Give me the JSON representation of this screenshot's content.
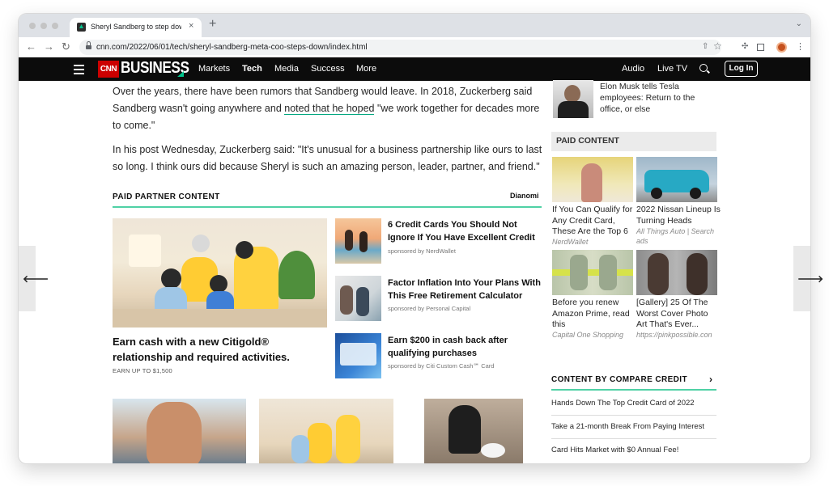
{
  "browser": {
    "tab_title": "Sheryl Sandberg to step down",
    "tab_close": "×",
    "new_tab": "+",
    "url": "cnn.com/2022/06/01/tech/sheryl-sandberg-meta-coo-steps-down/index.html"
  },
  "header": {
    "cnn_logo": "CNN",
    "section_logo": "BUSINESS",
    "nav": [
      "Markets",
      "Tech",
      "Media",
      "Success",
      "More"
    ],
    "right_nav": [
      "Audio",
      "Live TV"
    ],
    "login_label": "Log In"
  },
  "article": {
    "para1_a": "Over the years, there have been rumors that Sandberg would leave. In 2018, Zuckerberg said Sandberg wasn't going anywhere and ",
    "para1_link": "noted that he hoped",
    "para1_b": " \"we work together for decades more to come.\"",
    "para2": "In his post Wednesday, Zuckerberg said: \"It's unusual for a business partnership like ours to last so long. I think ours did because Sheryl is such an amazing person, leader, partner, and friend.\""
  },
  "paid_partner": {
    "heading": "PAID PARTNER CONTENT",
    "provider": "Dianomi",
    "hero": {
      "title": "Earn cash with a new Citigold® relationship and required activities.",
      "sub": "EARN UP TO $1,500"
    },
    "items": [
      {
        "title": "6 Credit Cards You Should Not Ignore If You Have Excellent Credit",
        "sponsor": "sponsored by NerdWallet"
      },
      {
        "title": "Factor Inflation Into Your Plans With This Free Retirement Calculator",
        "sponsor": "sponsored by Personal Capital"
      },
      {
        "title": "Earn $200 in cash back after qualifying purchases",
        "sponsor": "sponsored by Citi Custom Cash℠ Card"
      }
    ]
  },
  "rail": {
    "top_story": "Elon Musk tells Tesla employees: Return to the office, or else",
    "paid_content_label": "PAID CONTENT",
    "grid": [
      {
        "title": "If You Can Qualify for Any Credit Card, These Are the Top 6",
        "source": "NerdWallet"
      },
      {
        "title": "2022 Nissan Lineup Is Turning Heads",
        "source": "All Things Auto | Search ads"
      },
      {
        "title": "Before you renew Amazon Prime, read this",
        "source": "Capital One Shopping"
      },
      {
        "title": "[Gallery] 25 Of The Worst Cover Photo Art That's Ever...",
        "source": "https://pinkpossible.con"
      }
    ],
    "compare_heading": "CONTENT BY COMPARE CREDIT",
    "compare_items": [
      "Hands Down The Top Credit Card of 2022",
      "Take a 21-month Break From Paying Interest",
      "Card Hits Market with $0 Annual Fee!"
    ]
  },
  "colors": {
    "accent_green": "#4fd1a5",
    "cnn_red": "#cc0000",
    "header_bg": "#0c0c0c"
  },
  "icons": {
    "back": "←",
    "forward": "→",
    "reload": "↻",
    "share": "⇧",
    "star": "☆",
    "menu": "⋮",
    "carousel_prev": "🡐",
    "carousel_next": "🡒",
    "chevron": "›"
  }
}
